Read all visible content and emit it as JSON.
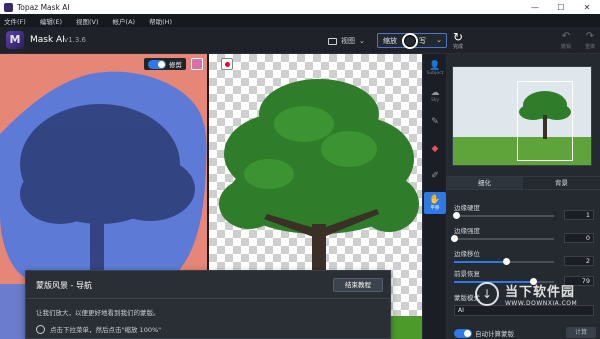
{
  "window": {
    "title": "Topaz Mask AI",
    "controls": [
      "—",
      "☐",
      "✕"
    ]
  },
  "menu": {
    "items": [
      "文件(F)",
      "编辑(E)",
      "视图(V)",
      "帐户(A)",
      "帮助(H)"
    ]
  },
  "toolbar": {
    "logo_letter": "M",
    "app_name": "Mask AI",
    "version": "v1.3.6",
    "view_label": "视图",
    "zoom_value": "缩放",
    "zoom_suffix": "写",
    "save_label": "完成",
    "undo_label": "撤销",
    "redo_label": "重做"
  },
  "canvas": {
    "cut_label": "修剪",
    "toggle_on": true
  },
  "tools": [
    {
      "name": "subject-tool",
      "label": "Subject",
      "icon": "👤"
    },
    {
      "name": "sky-tool",
      "label": "Sky",
      "icon": "☁"
    },
    {
      "name": "brush-tool",
      "label": "",
      "icon": "✎"
    },
    {
      "name": "eraser-tool",
      "label": "",
      "icon": "◆"
    },
    {
      "name": "picker-tool",
      "label": "",
      "icon": "✐"
    },
    {
      "name": "hand-tool",
      "label": "平移",
      "icon": "✋"
    }
  ],
  "panel": {
    "tabs": [
      "细化",
      "背景"
    ],
    "sliders": [
      {
        "label": "边缘硬度",
        "value": "1",
        "fraction": 0.02
      },
      {
        "label": "边缘强度",
        "value": "0",
        "fraction": 0.0
      },
      {
        "label": "边缘移位",
        "value": "2",
        "fraction": 0.52
      },
      {
        "label": "前景恢复",
        "value": "79",
        "fraction": 0.79
      }
    ],
    "dropdown_label": "蒙版模式",
    "dropdown_value": "AI",
    "auto_label": "自动计算蒙版",
    "auto_button": "计算"
  },
  "guide": {
    "title": "蒙版风景 - 导航",
    "end_button": "结束教程",
    "description": "让我们放大，以便更好地看到我们的蒙版。",
    "step": "点击下拉菜单，然后点击\"缩放 100%\""
  },
  "watermark": {
    "line1": "当下软件园",
    "line2": "WWW.DOWNXIA.COM"
  },
  "colors": {
    "accent": "#2f79e6",
    "left_bg": "#e68677",
    "overlay_blue": "#5d7ad6",
    "tree_green": "#2f7d2a"
  }
}
